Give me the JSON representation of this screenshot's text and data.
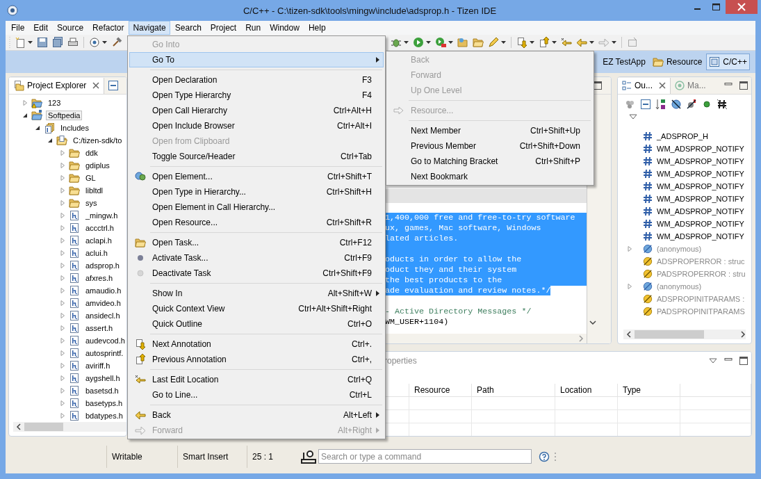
{
  "window": {
    "title": "C/C++ - C:\\tizen-sdk\\tools\\mingw\\include\\adsprop.h - Tizen IDE"
  },
  "menu_bar": [
    {
      "label": "File",
      "selected": false
    },
    {
      "label": "Edit",
      "selected": false
    },
    {
      "label": "Source",
      "selected": false
    },
    {
      "label": "Refactor",
      "selected": false
    },
    {
      "label": "Navigate",
      "selected": true
    },
    {
      "label": "Search",
      "selected": false
    },
    {
      "label": "Project",
      "selected": false
    },
    {
      "label": "Run",
      "selected": false
    },
    {
      "label": "Window",
      "selected": false
    },
    {
      "label": "Help",
      "selected": false
    }
  ],
  "perspectives": [
    {
      "label": "EZ TestApp",
      "selected": false
    },
    {
      "label": "Resource",
      "selected": false
    },
    {
      "label": "C/C++",
      "selected": true
    }
  ],
  "project_explorer": {
    "title": "Project Explorer",
    "tree": [
      {
        "label": "123",
        "kind": "project-warning",
        "expanded": false,
        "selected": false
      },
      {
        "label": "Softpedia",
        "kind": "project",
        "expanded": true,
        "selected": true,
        "children": [
          {
            "label": "Includes",
            "kind": "includes",
            "expanded": true,
            "selected": false,
            "children": [
              {
                "label": "C:/tizen-sdk/to",
                "kind": "include-path",
                "expanded": true,
                "selected": false,
                "children": [
                  {
                    "label": "ddk",
                    "kind": "folder",
                    "expanded": false,
                    "selected": false
                  },
                  {
                    "label": "gdiplus",
                    "kind": "folder",
                    "expanded": false,
                    "selected": false
                  },
                  {
                    "label": "GL",
                    "kind": "folder",
                    "expanded": false,
                    "selected": false
                  },
                  {
                    "label": "libltdl",
                    "kind": "folder",
                    "expanded": false,
                    "selected": false
                  },
                  {
                    "label": "sys",
                    "kind": "folder",
                    "expanded": false,
                    "selected": false
                  },
                  {
                    "label": "_mingw.h",
                    "kind": "header",
                    "expanded": false,
                    "selected": false
                  },
                  {
                    "label": "accctrl.h",
                    "kind": "header",
                    "expanded": false,
                    "selected": false
                  },
                  {
                    "label": "aclapi.h",
                    "kind": "header",
                    "expanded": false,
                    "selected": false
                  },
                  {
                    "label": "aclui.h",
                    "kind": "header",
                    "expanded": false,
                    "selected": false
                  },
                  {
                    "label": "adsprop.h",
                    "kind": "header",
                    "expanded": false,
                    "selected": false
                  },
                  {
                    "label": "afxres.h",
                    "kind": "header",
                    "expanded": false,
                    "selected": false
                  },
                  {
                    "label": "amaudio.h",
                    "kind": "header",
                    "expanded": false,
                    "selected": false
                  },
                  {
                    "label": "amvideo.h",
                    "kind": "header",
                    "expanded": false,
                    "selected": false
                  },
                  {
                    "label": "ansidecl.h",
                    "kind": "header",
                    "expanded": false,
                    "selected": false
                  },
                  {
                    "label": "assert.h",
                    "kind": "header",
                    "expanded": false,
                    "selected": false
                  },
                  {
                    "label": "audevcod.h",
                    "kind": "header",
                    "expanded": false,
                    "selected": false
                  },
                  {
                    "label": "autosprintf.",
                    "kind": "header",
                    "expanded": false,
                    "selected": false
                  },
                  {
                    "label": "aviriff.h",
                    "kind": "header",
                    "expanded": false,
                    "selected": false
                  },
                  {
                    "label": "aygshell.h",
                    "kind": "header",
                    "expanded": false,
                    "selected": false
                  },
                  {
                    "label": "basetsd.h",
                    "kind": "header",
                    "expanded": false,
                    "selected": false
                  },
                  {
                    "label": "basetyps.h",
                    "kind": "header",
                    "expanded": false,
                    "selected": false
                  },
                  {
                    "label": "bdatypes.h",
                    "kind": "header",
                    "expanded": false,
                    "selected": false
                  }
                ]
              }
            ]
          }
        ]
      }
    ]
  },
  "editor": {
    "lines": [
      {
        "text": "1,400,000 free and free-to-try software",
        "kind": "comment",
        "selected": true
      },
      {
        "text": "ux, games, Mac software, Windows",
        "kind": "comment",
        "selected": true
      },
      {
        "text": "lated articles.",
        "kind": "comment",
        "selected": true
      },
      {
        "selected": true
      },
      {
        "text": "oducts in order to allow the",
        "kind": "comment",
        "selected": true
      },
      {
        "text": "oduct they and their system",
        "kind": "comment",
        "selected": true
      },
      {
        "text": "the best products to the",
        "kind": "comment",
        "selected": true
      },
      {
        "text": "ade evaluation and review notes.*/",
        "kind": "comment",
        "selected": true
      },
      {
        "selected": false
      },
      {
        "text": "- Active Directory Messages */",
        "kind": "comment",
        "selected": false
      },
      {
        "text": "WM_USER+1104)",
        "kind": "code",
        "selected": false
      }
    ]
  },
  "outline": {
    "tabs": [
      {
        "label": "Ou...",
        "selected": true
      },
      {
        "label": "Ma...",
        "selected": false
      }
    ],
    "items": [
      {
        "label": "_ADSPROP_H",
        "kind": "macro"
      },
      {
        "label": "WM_ADSPROP_NOTIFY",
        "kind": "macro"
      },
      {
        "label": "WM_ADSPROP_NOTIFY",
        "kind": "macro"
      },
      {
        "label": "WM_ADSPROP_NOTIFY",
        "kind": "macro"
      },
      {
        "label": "WM_ADSPROP_NOTIFY",
        "kind": "macro"
      },
      {
        "label": "WM_ADSPROP_NOTIFY",
        "kind": "macro"
      },
      {
        "label": "WM_ADSPROP_NOTIFY",
        "kind": "macro"
      },
      {
        "label": "WM_ADSPROP_NOTIFY",
        "kind": "macro"
      },
      {
        "label": "WM_ADSPROP_NOTIFY",
        "kind": "macro"
      },
      {
        "label": "(anonymous)",
        "kind": "struct",
        "expanded": false
      },
      {
        "label": "ADSPROPERROR : struc",
        "kind": "typedef"
      },
      {
        "label": "PADSPROPERROR : stru",
        "kind": "typedef"
      },
      {
        "label": "(anonymous)",
        "kind": "struct",
        "expanded": false
      },
      {
        "label": "ADSPROPINITPARAMS :",
        "kind": "typedef"
      },
      {
        "label": "PADSPROPINITPARAMS",
        "kind": "typedef"
      }
    ]
  },
  "bottom_panel": {
    "tab": "roperties",
    "columns": [
      "Resource",
      "Path",
      "Location",
      "Type"
    ]
  },
  "status_bar": {
    "mode": "Writable",
    "insert_mode": "Smart Insert",
    "position": "25 : 1",
    "search": {
      "placeholder": "Search or type a command"
    }
  },
  "navigate_menu": {
    "items": [
      {
        "kind": "item",
        "label": "Go Into",
        "disabled": true,
        "selected": false,
        "submenu": false
      },
      {
        "kind": "item",
        "label": "Go To",
        "disabled": false,
        "selected": true,
        "submenu": true
      },
      {
        "kind": "separator"
      },
      {
        "kind": "item",
        "label": "Open Declaration",
        "shortcut": "F3",
        "disabled": false,
        "selected": false,
        "submenu": false
      },
      {
        "kind": "item",
        "label": "Open Type Hierarchy",
        "shortcut": "F4",
        "disabled": false,
        "selected": false,
        "submenu": false
      },
      {
        "kind": "item",
        "label": "Open Call Hierarchy",
        "shortcut": "Ctrl+Alt+H",
        "disabled": false,
        "selected": false,
        "submenu": false
      },
      {
        "kind": "item",
        "label": "Open Include Browser",
        "shortcut": "Ctrl+Alt+I",
        "disabled": false,
        "selected": false,
        "submenu": false
      },
      {
        "kind": "item",
        "label": "Open from Clipboard",
        "disabled": true,
        "selected": false,
        "submenu": false
      },
      {
        "kind": "item",
        "label": "Toggle Source/Header",
        "shortcut": "Ctrl+Tab",
        "disabled": false,
        "selected": false,
        "submenu": false
      },
      {
        "kind": "separator"
      },
      {
        "kind": "item",
        "label": "Open Element...",
        "shortcut": "Ctrl+Shift+T",
        "disabled": false,
        "selected": false,
        "submenu": false
      },
      {
        "kind": "item",
        "label": "Open Type in Hierarchy...",
        "shortcut": "Ctrl+Shift+H",
        "disabled": false,
        "selected": false,
        "submenu": false
      },
      {
        "kind": "item",
        "label": "Open Element in Call Hierarchy...",
        "disabled": false,
        "selected": false,
        "submenu": false
      },
      {
        "kind": "item",
        "label": "Open Resource...",
        "shortcut": "Ctrl+Shift+R",
        "disabled": false,
        "selected": false,
        "submenu": false
      },
      {
        "kind": "separator"
      },
      {
        "kind": "item",
        "label": "Open Task...",
        "shortcut": "Ctrl+F12",
        "disabled": false,
        "selected": false,
        "submenu": false
      },
      {
        "kind": "item",
        "label": "Activate Task...",
        "shortcut": "Ctrl+F9",
        "disabled": false,
        "selected": false,
        "submenu": false
      },
      {
        "kind": "item",
        "label": "Deactivate Task",
        "shortcut": "Ctrl+Shift+F9",
        "disabled": false,
        "selected": false,
        "submenu": false
      },
      {
        "kind": "separator"
      },
      {
        "kind": "item",
        "label": "Show In",
        "shortcut": "Alt+Shift+W",
        "disabled": false,
        "selected": false,
        "submenu": true
      },
      {
        "kind": "item",
        "label": "Quick Context View",
        "shortcut": "Ctrl+Alt+Shift+Right",
        "disabled": false,
        "selected": false,
        "submenu": false
      },
      {
        "kind": "item",
        "label": "Quick Outline",
        "shortcut": "Ctrl+O",
        "disabled": false,
        "selected": false,
        "submenu": false
      },
      {
        "kind": "separator"
      },
      {
        "kind": "item",
        "label": "Next Annotation",
        "shortcut": "Ctrl+.",
        "disabled": false,
        "selected": false,
        "submenu": false
      },
      {
        "kind": "item",
        "label": "Previous Annotation",
        "shortcut": "Ctrl+,",
        "disabled": false,
        "selected": false,
        "submenu": false
      },
      {
        "kind": "separator"
      },
      {
        "kind": "item",
        "label": "Last Edit Location",
        "shortcut": "Ctrl+Q",
        "disabled": false,
        "selected": false,
        "submenu": false
      },
      {
        "kind": "item",
        "label": "Go to Line...",
        "shortcut": "Ctrl+L",
        "disabled": false,
        "selected": false,
        "submenu": false
      },
      {
        "kind": "separator"
      },
      {
        "kind": "item",
        "label": "Back",
        "shortcut": "Alt+Left",
        "disabled": false,
        "selected": false,
        "submenu": true
      },
      {
        "kind": "item",
        "label": "Forward",
        "shortcut": "Alt+Right",
        "disabled": true,
        "selected": false,
        "submenu": true
      }
    ]
  },
  "goto_submenu": {
    "items": [
      {
        "kind": "item",
        "label": "Back",
        "disabled": true,
        "selected": false,
        "submenu": false
      },
      {
        "kind": "item",
        "label": "Forward",
        "disabled": true,
        "selected": false,
        "submenu": false
      },
      {
        "kind": "item",
        "label": "Up One Level",
        "disabled": true,
        "selected": false,
        "submenu": false
      },
      {
        "kind": "separator"
      },
      {
        "kind": "item",
        "label": "Resource...",
        "disabled": true,
        "selected": false,
        "submenu": false
      },
      {
        "kind": "separator"
      },
      {
        "kind": "item",
        "label": "Next Member",
        "shortcut": "Ctrl+Shift+Up",
        "disabled": false,
        "selected": false,
        "submenu": false
      },
      {
        "kind": "item",
        "label": "Previous Member",
        "shortcut": "Ctrl+Shift+Down",
        "disabled": false,
        "selected": false,
        "submenu": false
      },
      {
        "kind": "item",
        "label": "Go to Matching Bracket",
        "shortcut": "Ctrl+Shift+P",
        "disabled": false,
        "selected": false,
        "submenu": false
      },
      {
        "kind": "item",
        "label": "Next Bookmark",
        "disabled": false,
        "selected": false,
        "submenu": false
      }
    ]
  }
}
